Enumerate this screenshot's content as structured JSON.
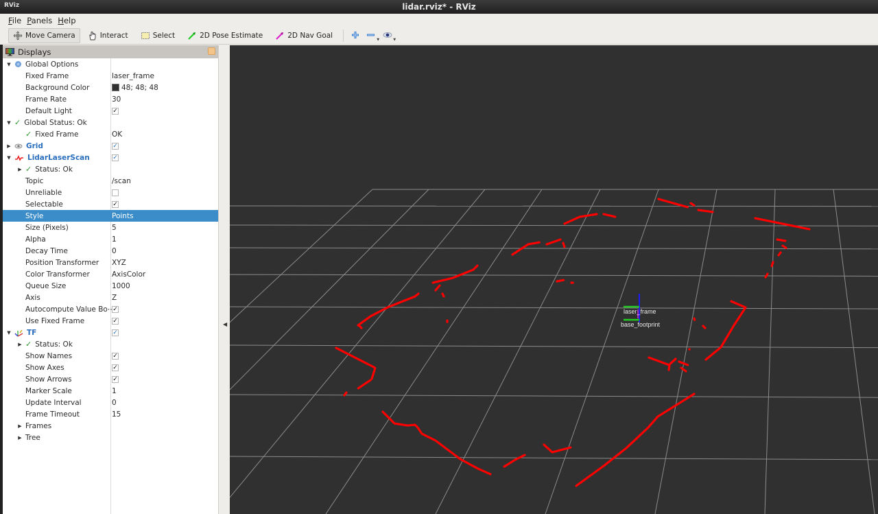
{
  "window": {
    "app_icon": "RViz",
    "title": "lidar.rviz* - RViz"
  },
  "menubar": {
    "items": [
      {
        "label": "File",
        "mnemonic": "F",
        "rest": "ile"
      },
      {
        "label": "Panels",
        "mnemonic": "P",
        "rest": "anels"
      },
      {
        "label": "Help",
        "mnemonic": "H",
        "rest": "elp"
      }
    ]
  },
  "toolbar": {
    "tools": [
      {
        "label": "Move Camera",
        "icon": "move-camera-icon",
        "active": true
      },
      {
        "label": "Interact",
        "icon": "hand-pointer-icon"
      },
      {
        "label": "Select",
        "icon": "select-rect-icon"
      },
      {
        "label": "2D Pose Estimate",
        "icon": "green-arrow-icon",
        "color": "#22cc22"
      },
      {
        "label": "2D Nav Goal",
        "icon": "magenta-arrow-icon",
        "color": "#dd22cc"
      }
    ],
    "icon_buttons": [
      "add-tool-icon",
      "remove-tool-icon",
      "view-eye-icon"
    ]
  },
  "displays": {
    "title": "Displays",
    "rows": [
      {
        "indent": 0,
        "arrow": "down",
        "icon": "global-options-icon",
        "name": "Global Options",
        "value": ""
      },
      {
        "indent": 1,
        "name": "Fixed Frame",
        "value": "laser_frame"
      },
      {
        "indent": 1,
        "name": "Background Color",
        "value": "48; 48; 48",
        "swatch": "#303030"
      },
      {
        "indent": 1,
        "name": "Frame Rate",
        "value": "30"
      },
      {
        "indent": 1,
        "name": "Default Light",
        "checkbox": true
      },
      {
        "indent": 0,
        "arrow": "down",
        "icon": "status-ok-icon",
        "name": "Global Status: Ok",
        "value": ""
      },
      {
        "indent": 1,
        "icon": "status-ok-icon",
        "name": "Fixed Frame",
        "value": "OK",
        "iconrow": true
      },
      {
        "indent": 0,
        "arrow": "right",
        "icon": "grid-icon",
        "name": "Grid",
        "checkbox": true,
        "blue": true
      },
      {
        "indent": 0,
        "arrow": "down",
        "icon": "laserscan-icon",
        "name": "LidarLaserScan",
        "checkbox": true,
        "blue": true
      },
      {
        "indent": 1,
        "arrow": "right",
        "icon": "status-ok-icon",
        "name": "Status: Ok",
        "value": "",
        "iconrow": true
      },
      {
        "indent": 1,
        "name": "Topic",
        "value": "/scan"
      },
      {
        "indent": 1,
        "name": "Unreliable",
        "checkbox": false
      },
      {
        "indent": 1,
        "name": "Selectable",
        "checkbox": true
      },
      {
        "indent": 1,
        "name": "Style",
        "value": "Points",
        "selected": true
      },
      {
        "indent": 1,
        "name": "Size (Pixels)",
        "value": "5"
      },
      {
        "indent": 1,
        "name": "Alpha",
        "value": "1"
      },
      {
        "indent": 1,
        "name": "Decay Time",
        "value": "0"
      },
      {
        "indent": 1,
        "name": "Position Transformer",
        "value": "XYZ"
      },
      {
        "indent": 1,
        "name": "Color Transformer",
        "value": "AxisColor"
      },
      {
        "indent": 1,
        "name": "Queue Size",
        "value": "1000"
      },
      {
        "indent": 1,
        "name": "Axis",
        "value": "Z"
      },
      {
        "indent": 1,
        "name": "Autocompute Value Bo⋯",
        "checkbox": true
      },
      {
        "indent": 1,
        "name": "Use Fixed Frame",
        "checkbox": true
      },
      {
        "indent": 0,
        "arrow": "down",
        "icon": "tf-icon",
        "name": "TF",
        "checkbox": true,
        "blue": true
      },
      {
        "indent": 1,
        "arrow": "right",
        "icon": "status-ok-icon",
        "name": "Status: Ok",
        "value": "",
        "iconrow": true
      },
      {
        "indent": 1,
        "name": "Show Names",
        "checkbox": true
      },
      {
        "indent": 1,
        "name": "Show Axes",
        "checkbox": true
      },
      {
        "indent": 1,
        "name": "Show Arrows",
        "checkbox": true
      },
      {
        "indent": 1,
        "name": "Marker Scale",
        "value": "1"
      },
      {
        "indent": 1,
        "name": "Update Interval",
        "value": "0"
      },
      {
        "indent": 1,
        "name": "Frame Timeout",
        "value": "15"
      },
      {
        "indent": 1,
        "arrow": "right",
        "name": "Frames",
        "value": ""
      },
      {
        "indent": 1,
        "arrow": "right",
        "name": "Tree",
        "value": ""
      }
    ]
  },
  "viewport": {
    "background": "#303030",
    "grid_color": "#8c8c8c",
    "scan_color": "#ff0000",
    "tf_frames": [
      {
        "name": "laser_frame"
      },
      {
        "name": "base_footprint"
      }
    ]
  }
}
